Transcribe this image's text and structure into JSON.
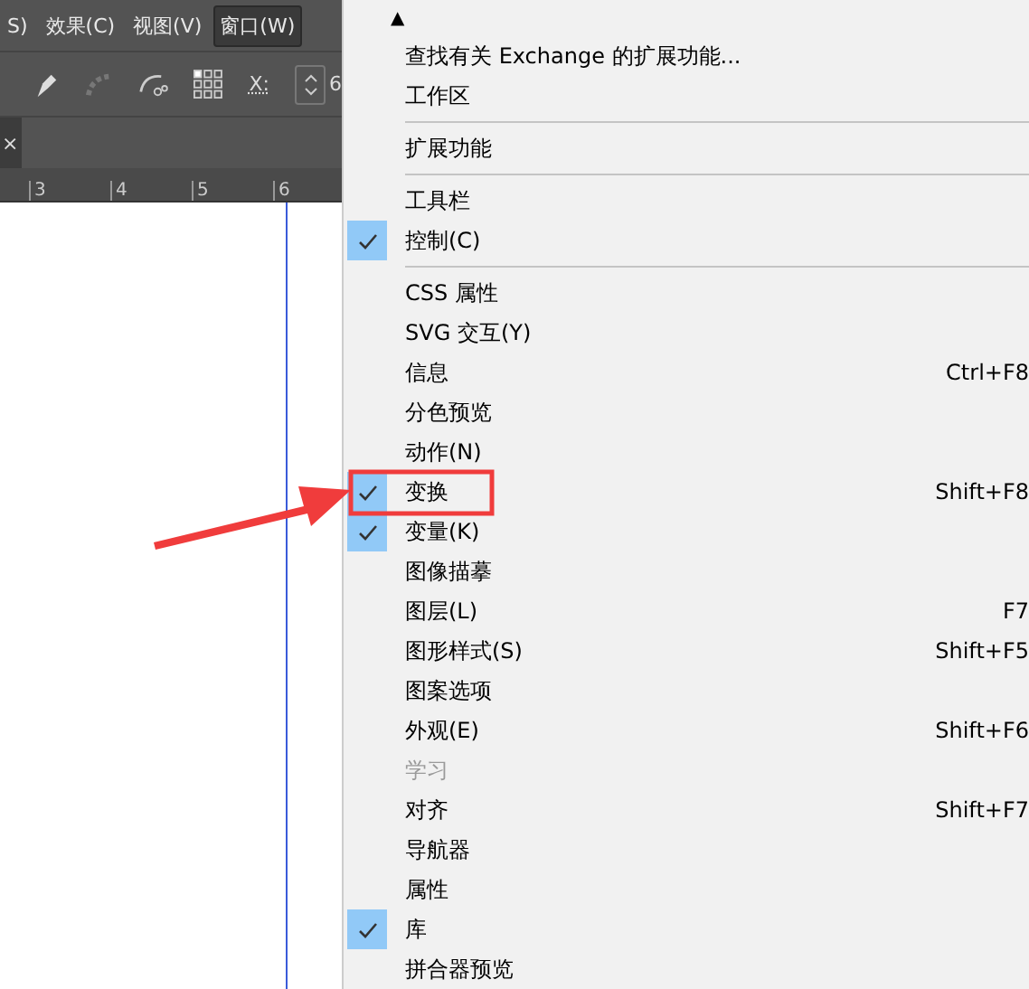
{
  "menubar": [
    {
      "label": "S)",
      "selected": false
    },
    {
      "label": "效果(C)",
      "selected": false
    },
    {
      "label": "视图(V)",
      "selected": false
    },
    {
      "label": "窗口(W)",
      "selected": true
    }
  ],
  "toolbar": {
    "x_label": "X:",
    "x_value": "6"
  },
  "tab_close": "×",
  "ruler": [
    "3",
    "4",
    "5",
    "6"
  ],
  "scroll_arrow": "▲",
  "menu": [
    {
      "label": "查找有关 Exchange 的扩展功能...",
      "checked": false,
      "disabled": false,
      "separator_after": false
    },
    {
      "label": "工作区",
      "checked": false,
      "disabled": false,
      "separator_after": true
    },
    {
      "label": "扩展功能",
      "checked": false,
      "disabled": false,
      "separator_after": true
    },
    {
      "label": "工具栏",
      "checked": false,
      "disabled": false,
      "separator_after": false
    },
    {
      "label": "控制(C)",
      "checked": true,
      "disabled": false,
      "separator_after": true
    },
    {
      "label": "CSS 属性",
      "checked": false,
      "disabled": false,
      "separator_after": false
    },
    {
      "label": "SVG 交互(Y)",
      "checked": false,
      "disabled": false,
      "separator_after": false
    },
    {
      "label": "信息",
      "shortcut": "Ctrl+F8",
      "checked": false,
      "disabled": false,
      "separator_after": false
    },
    {
      "label": "分色预览",
      "checked": false,
      "disabled": false,
      "separator_after": false
    },
    {
      "label": "动作(N)",
      "checked": false,
      "disabled": false,
      "separator_after": false
    },
    {
      "label": "变换",
      "shortcut": "Shift+F8",
      "checked": true,
      "disabled": false,
      "separator_after": false
    },
    {
      "label": "变量(K)",
      "checked": true,
      "disabled": false,
      "separator_after": false
    },
    {
      "label": "图像描摹",
      "checked": false,
      "disabled": false,
      "separator_after": false
    },
    {
      "label": "图层(L)",
      "shortcut": "F7",
      "checked": false,
      "disabled": false,
      "separator_after": false
    },
    {
      "label": "图形样式(S)",
      "shortcut": "Shift+F5",
      "checked": false,
      "disabled": false,
      "separator_after": false
    },
    {
      "label": "图案选项",
      "checked": false,
      "disabled": false,
      "separator_after": false
    },
    {
      "label": "外观(E)",
      "shortcut": "Shift+F6",
      "checked": false,
      "disabled": false,
      "separator_after": false
    },
    {
      "label": "学习",
      "checked": false,
      "disabled": true,
      "separator_after": false
    },
    {
      "label": "对齐",
      "shortcut": "Shift+F7",
      "checked": false,
      "disabled": false,
      "separator_after": false
    },
    {
      "label": "导航器",
      "checked": false,
      "disabled": false,
      "separator_after": false
    },
    {
      "label": "属性",
      "checked": false,
      "disabled": false,
      "separator_after": false
    },
    {
      "label": "库",
      "checked": true,
      "disabled": false,
      "separator_after": false
    },
    {
      "label": "拼合器预览",
      "checked": false,
      "disabled": false,
      "separator_after": false
    }
  ]
}
